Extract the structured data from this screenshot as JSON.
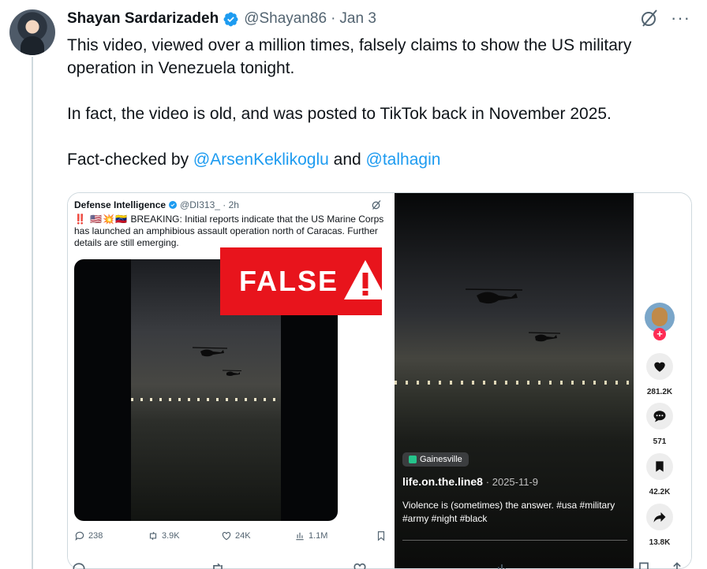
{
  "author": {
    "name": "Shayan Sardarizadeh",
    "handle": "@Shayan86",
    "separator": "·",
    "date": "Jan 3"
  },
  "tweet": {
    "line1": "This video, viewed over a million times, falsely claims to show the US military operation in Venezuela tonight.",
    "line2": "In fact, the video is old, and was posted to TikTok back in November 2025.",
    "line3_prefix": "Fact-checked by ",
    "mention1": "@ArsenKeklikoglu",
    "line3_mid": " and ",
    "mention2": "@talhagin"
  },
  "left_card": {
    "name": "Defense Intelligence",
    "handle": "@DI313_",
    "time": "· 2h",
    "flags": "‼️ 🇺🇸💥🇻🇪",
    "text": "BREAKING: Initial reports indicate that the US Marine Corps has launched an amphibious assault operation north of Caracas. Further details are still emerging.",
    "banner": "FALSE",
    "actions": {
      "replies": "238",
      "reposts": "3.9K",
      "likes": "24K",
      "views": "1.1M"
    }
  },
  "tiktok": {
    "location": "Gainesville",
    "user": "life.on.the.line8",
    "date": "· 2025-11-9",
    "caption": "Violence is (sometimes) the answer. #usa #military #army #night #black",
    "likes": "281.2K",
    "comments": "571",
    "saves": "42.2K",
    "shares": "13.8K"
  },
  "colors": {
    "accent": "#1d9bf0",
    "false_red": "#e8141c",
    "tiktok_pink": "#fe2c55"
  },
  "icons": [
    "verified-badge-icon",
    "grok-icon",
    "more-icon",
    "reply-icon",
    "repost-icon",
    "like-icon",
    "views-icon",
    "bookmark-icon",
    "heart-icon",
    "comment-icon",
    "share-icon",
    "warning-icon",
    "location-pin-icon"
  ]
}
